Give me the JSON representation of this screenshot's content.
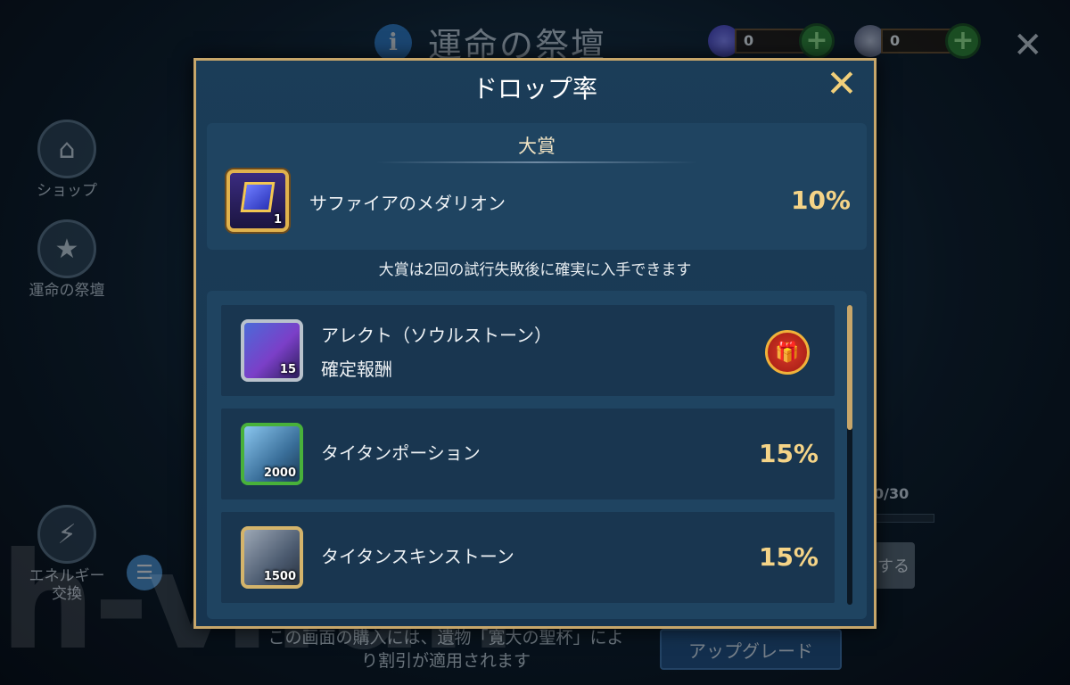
{
  "background": {
    "title": "運命の祭壇",
    "currency": [
      {
        "icon": "sapphire-orb-icon",
        "value": "0",
        "color": "#6a63d8"
      },
      {
        "icon": "crystal-star-icon",
        "value": "0",
        "color": "#8a8fa6"
      }
    ],
    "side_menu": [
      {
        "label": "ショップ",
        "icon": "shop-icon"
      },
      {
        "label": "運命の祭壇",
        "icon": "star-badge-icon"
      },
      {
        "label": "エネルギー\n交換",
        "icon": "energy-exchange-icon"
      }
    ],
    "notice": "この画面の購入には、遺物「寛大の聖杯」により割引が適用されます",
    "upgrade_label": "アップグレード",
    "counter": "0/30",
    "buy_label": "する"
  },
  "watermark": "h-v.fun",
  "modal": {
    "title": "ドロップ率",
    "grand_prize": {
      "heading": "大賞",
      "item_name": "サファイアのメダリオン",
      "quantity": "1",
      "rate": "10%"
    },
    "guarantee_text": "大賞は2回の試行失敗後に確実に入手できます",
    "items": [
      {
        "name": "アレクト（ソウルストーン）",
        "subtitle": "確定報酬",
        "quantity": "15",
        "rate": "",
        "icon": "soulstone-icon"
      },
      {
        "name": "タイタンポーション",
        "subtitle": "",
        "quantity": "2000",
        "rate": "15%",
        "icon": "potion-icon"
      },
      {
        "name": "タイタンスキンストーン",
        "subtitle": "",
        "quantity": "1500",
        "rate": "15%",
        "icon": "skin-stone-icon"
      }
    ]
  }
}
